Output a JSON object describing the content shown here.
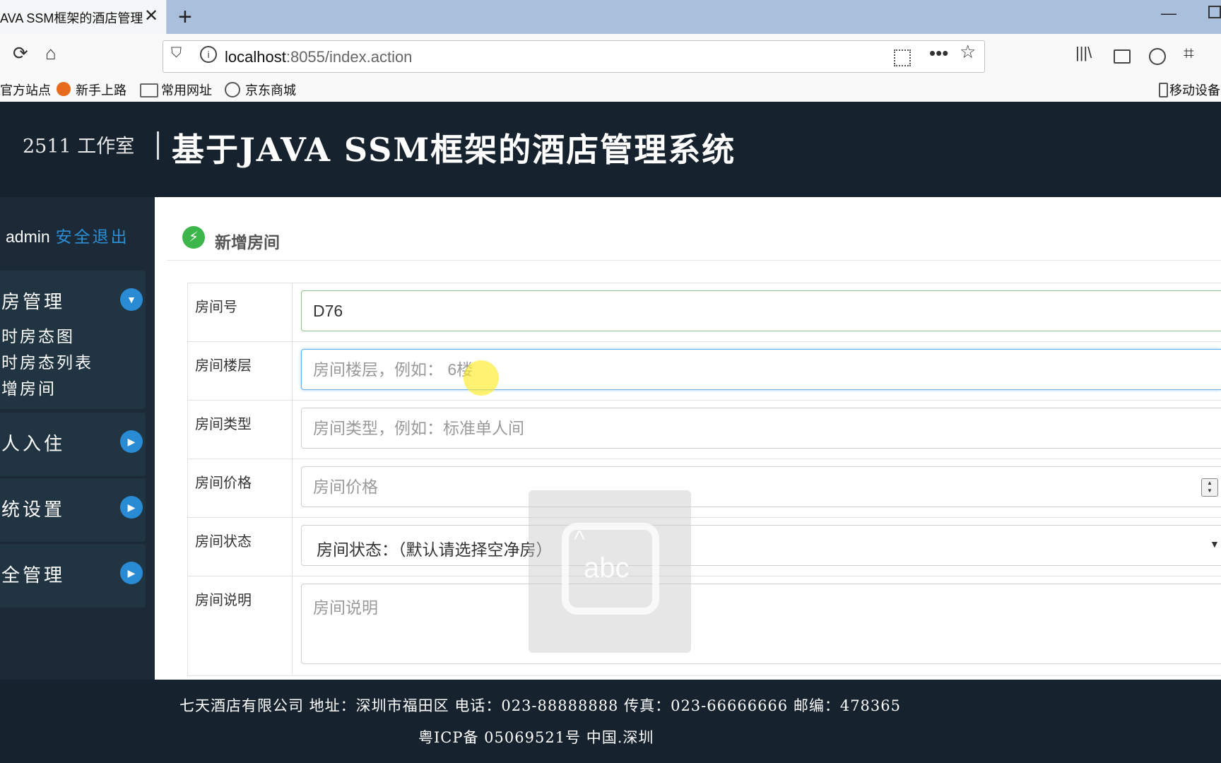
{
  "browser": {
    "tab_title": "AVA SSM框架的酒店管理",
    "url_host": "localhost",
    "url_rest": ":8055/index.action",
    "bookmarks": [
      "官方站点",
      "新手上路",
      "常用网址",
      "京东商城"
    ],
    "mobile_bookmarks": "移动设备"
  },
  "app": {
    "studio": "2511 工作室",
    "title": "基于JAVA SSM框架的酒店管理系统"
  },
  "sidebar": {
    "username": "admin",
    "logout": "安全退出",
    "groups": [
      {
        "label": "房管理",
        "expanded": true,
        "items": [
          "时房态图",
          "时房态列表",
          "增房间"
        ]
      },
      {
        "label": "人入住",
        "expanded": false
      },
      {
        "label": "统设置",
        "expanded": false
      },
      {
        "label": "全管理",
        "expanded": false
      }
    ]
  },
  "page": {
    "title": "新增房间"
  },
  "form": {
    "room_number": {
      "label": "房间号",
      "value": "D76"
    },
    "floor": {
      "label": "房间楼层",
      "placeholder": "房间楼层，例如： 6楼"
    },
    "type": {
      "label": "房间类型",
      "placeholder": "房间类型，例如：标准单人间"
    },
    "price": {
      "label": "房间价格",
      "placeholder": "房间价格"
    },
    "status": {
      "label": "房间状态",
      "selected": "房间状态：（默认请选择空净房）"
    },
    "description": {
      "label": "房间说明",
      "placeholder": "房间说明"
    }
  },
  "overlay": {
    "ime_text": "abc"
  },
  "footer": {
    "line1": "七天酒店有限公司 地址：深圳市福田区 电话：023-88888888 传真：023-66666666 邮编：478365",
    "line2": "粤ICP备 05069521号 中国.深圳"
  }
}
